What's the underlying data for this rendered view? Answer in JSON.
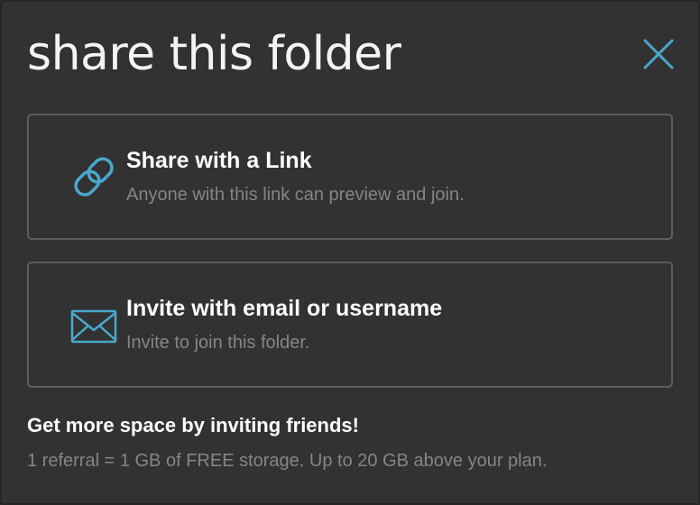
{
  "dialog": {
    "title": "share this folder",
    "close_icon": "close-icon"
  },
  "options": [
    {
      "title": "Share with a Link",
      "subtitle": "Anyone with this link can preview and join.",
      "icon": "link-icon"
    },
    {
      "title": "Invite with email or username",
      "subtitle": "Invite to join this folder.",
      "icon": "envelope-icon"
    }
  ],
  "promo": {
    "title": "Get more space by inviting friends!",
    "text": "1 referral = 1 GB of FREE storage. Up to 20 GB above your plan."
  },
  "colors": {
    "background": "#323232",
    "accent": "#4aa8cc",
    "card_border": "#5d5d5d",
    "muted_text": "#858585"
  }
}
